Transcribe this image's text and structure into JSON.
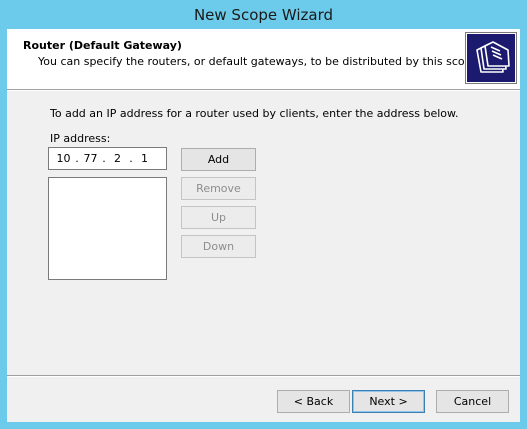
{
  "window": {
    "title": "New Scope Wizard"
  },
  "header": {
    "title": "Router (Default Gateway)",
    "subtitle": "You can specify the routers, or default gateways, to be distributed by this scope.",
    "icon": "wizard-folders-icon"
  },
  "main": {
    "instruction": "To add an IP address for a router used by clients, enter the address below.",
    "ip_label": "IP address:",
    "ip_address": {
      "octets": [
        "10",
        "77",
        "2",
        "1"
      ],
      "separator": "."
    },
    "router_list": [],
    "buttons": {
      "add": "Add",
      "remove": "Remove",
      "up": "Up",
      "down": "Down"
    }
  },
  "footer": {
    "back": "< Back",
    "next": "Next >",
    "cancel": "Cancel"
  },
  "colors": {
    "window_frame": "#6ccbea",
    "client_bg": "#f0f0f0",
    "header_bg": "#ffffff",
    "icon_bg": "#1b1a6e",
    "default_button_border": "#3c7fb1",
    "disabled_text": "#8d8d8d"
  }
}
